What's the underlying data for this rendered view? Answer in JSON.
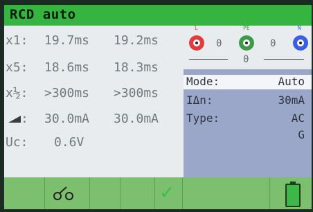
{
  "header": {
    "title": "RCD auto"
  },
  "measurements": [
    {
      "label": "x1:",
      "value1": "19.7ms",
      "value2": "19.2ms"
    },
    {
      "label": "x5:",
      "value1": "18.6ms",
      "value2": "18.3ms"
    },
    {
      "label": "x½:",
      "value1": ">300ms",
      "value2": ">300ms"
    },
    {
      "label": ":",
      "value1": "30.0mA",
      "value2": "30.0mA"
    },
    {
      "label": "Uc:",
      "value1": "0.6V"
    }
  ],
  "terminals": {
    "L": {
      "label": "L",
      "color": "#e23b3b"
    },
    "PE": {
      "label": "PE",
      "color": "#3f9a48"
    },
    "N": {
      "label": "N",
      "color": "#3a5fe6"
    },
    "readings": {
      "l_pe": "0",
      "pe_n": "0",
      "l_n": "0"
    }
  },
  "settings": {
    "mode": {
      "label": "Mode:",
      "value": "Auto"
    },
    "current": {
      "label": "IΔn:",
      "value": "30mA"
    },
    "type": {
      "label": "Type:",
      "value": "AC",
      "extra": "G"
    }
  },
  "bottom_bar": {
    "buttons": [
      "",
      "wiring-icon",
      "",
      "",
      "check-icon",
      "",
      "battery-icon"
    ],
    "check_glyph": "✓",
    "colors": {
      "bar": "#7bbf6f",
      "check": "#35c043",
      "battery": "#3fb64a"
    }
  }
}
